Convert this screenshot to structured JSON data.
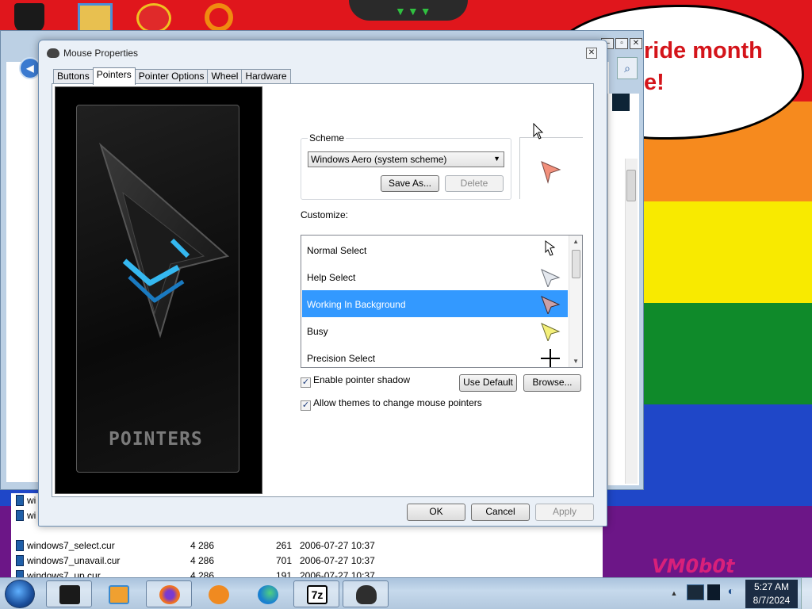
{
  "desktop": {
    "banner_text": "ride month\ne!",
    "watermark": "VM0b0t"
  },
  "background_window": {
    "files": [
      {
        "name": "wi",
        "size": "",
        "num": "",
        "date": ""
      },
      {
        "name": "wi",
        "size": "",
        "num": "",
        "date": ""
      },
      {
        "name": "windows7_select.cur",
        "size": "4 286",
        "num": "261",
        "date": "2006-07-27 10:37"
      },
      {
        "name": "windows7_unavail.cur",
        "size": "4 286",
        "num": "701",
        "date": "2006-07-27 10:37"
      },
      {
        "name": "windows7_up.cur",
        "size": "4 286",
        "num": "191",
        "date": "2006-07-27 10:37"
      }
    ]
  },
  "dialog": {
    "title": "Mouse Properties",
    "tabs": [
      "Buttons",
      "Pointers",
      "Pointer Options",
      "Wheel",
      "Hardware"
    ],
    "active_tab": "Pointers",
    "preview_art_label": "POINTERS",
    "scheme": {
      "legend": "Scheme",
      "selected": "Windows Aero (system scheme)",
      "save_as": "Save As...",
      "delete": "Delete"
    },
    "customize_label": "Customize:",
    "cursor_list": [
      {
        "label": "Normal Select",
        "icon": "arrow-cursor-icon",
        "selected": false
      },
      {
        "label": "Help Select",
        "icon": "help-cursor-icon",
        "selected": false
      },
      {
        "label": "Working In Background",
        "icon": "working-cursor-icon",
        "selected": true
      },
      {
        "label": "Busy",
        "icon": "busy-cursor-icon",
        "selected": false
      },
      {
        "label": "Precision Select",
        "icon": "crosshair-cursor-icon",
        "selected": false
      }
    ],
    "enable_shadow": {
      "label": "Enable pointer shadow",
      "checked": true
    },
    "allow_themes": {
      "label": "Allow themes to change mouse pointers",
      "checked": true
    },
    "use_default": "Use Default",
    "browse": "Browse...",
    "ok": "OK",
    "cancel": "Cancel",
    "apply": "Apply"
  },
  "taskbar": {
    "apps": [
      "computer-icon",
      "media-player-icon",
      "firefox-icon",
      "uc-browser-icon",
      "edge-icon",
      "7zip-icon",
      "mouse-icon"
    ],
    "clock_time": "5:27 AM",
    "clock_date": "8/7/2024",
    "seven_zip_label": "7z"
  },
  "colors": {
    "selection": "#3399ff",
    "dialog_bg": "#eaf0f7",
    "taskbar": "#b9cfe4"
  }
}
